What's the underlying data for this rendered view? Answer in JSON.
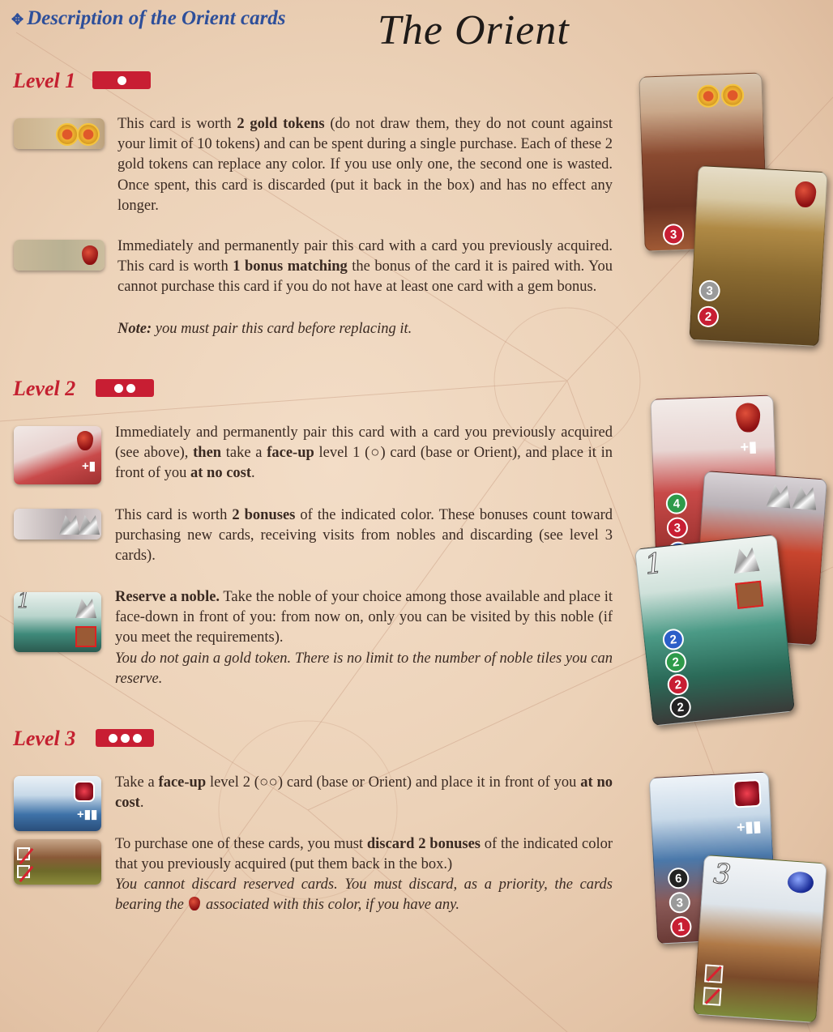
{
  "header": {
    "description": "Description of the Orient cards",
    "title": "The Orient"
  },
  "levels": [
    {
      "label": "Level 1",
      "blocks": [
        {
          "paragraph": [
            {
              "t": "This card is worth "
            },
            {
              "t": "2 gold tokens",
              "b": true
            },
            {
              "t": " (do not draw them, they do not count against your limit of 10 tokens) and can be spent during a single purchase. Each of these 2 gold tokens can replace any color. If you use only one, the second one is wasted. Once spent, this card is discarded (put it back in the box) and has no effect any longer."
            }
          ]
        },
        {
          "paragraph": [
            {
              "t": "Immediately and permanently pair this card with a card you previously acquired. This card is worth "
            },
            {
              "t": "1 bonus matching",
              "b": true
            },
            {
              "t": " the bonus of the card it is paired with. You cannot purchase this card if you do not have at least one card with a gem bonus."
            }
          ],
          "note": [
            {
              "t": "Note:",
              "b": true,
              "i": true
            },
            {
              "t": " you must pair this card before replacing it.",
              "i": true
            }
          ]
        }
      ]
    },
    {
      "label": "Level 2",
      "blocks": [
        {
          "paragraph": [
            {
              "t": "Immediately and permanently pair this card with a card you previously acquired (see above), "
            },
            {
              "t": "then",
              "b": true
            },
            {
              "t": " take a "
            },
            {
              "t": "face-up",
              "b": true
            },
            {
              "t": " level 1 (○) card (base or Orient), and place it in front of you "
            },
            {
              "t": "at no cost",
              "b": true
            },
            {
              "t": "."
            }
          ]
        },
        {
          "paragraph": [
            {
              "t": "This card is worth "
            },
            {
              "t": "2 bonuses",
              "b": true
            },
            {
              "t": " of the indicated color. These bonuses count toward purchasing new cards, receiving visits from nobles and discarding (see level 3 cards)."
            }
          ]
        },
        {
          "paragraph": [
            {
              "t": "Reserve a noble.",
              "b": true
            },
            {
              "t": " Take the noble of your choice among those available and place it face-down in front of you: from now on, only you can be visited by this noble (if you meet the requirements)."
            }
          ],
          "note": [
            {
              "t": "You do not gain a gold token. There is no limit to the number of noble tiles you can reserve.",
              "i": true
            }
          ]
        }
      ]
    },
    {
      "label": "Level 3",
      "blocks": [
        {
          "paragraph": [
            {
              "t": "Take a "
            },
            {
              "t": "face-up",
              "b": true
            },
            {
              "t": " level 2 (○○) card (base or Orient) and place it in front of you "
            },
            {
              "t": "at no cost",
              "b": true
            },
            {
              "t": "."
            }
          ]
        },
        {
          "paragraph": [
            {
              "t": "To purchase one of these cards, you must "
            },
            {
              "t": "discard 2 bonuses",
              "b": true
            },
            {
              "t": " of the indicated color that you previously acquired (put them back in the box.)"
            }
          ],
          "note": [
            {
              "t": "You cannot discard reserved cards. You must discard, as a priority, the cards bearing the ",
              "i": true
            },
            {
              "icon": "ruby-drop-icon"
            },
            {
              "t": " associated with this color, if you have any.",
              "i": true
            }
          ]
        }
      ]
    }
  ],
  "cards": {
    "l1a": {
      "cost": [
        "3"
      ]
    },
    "l1b": {
      "cost": [
        "3",
        "2"
      ]
    },
    "l2a": {
      "cost": [
        "4",
        "3",
        "1"
      ]
    },
    "l2c": {
      "number": "1",
      "cost": [
        "2",
        "2",
        "2",
        "2"
      ]
    },
    "l3a": {
      "cost": [
        "6",
        "3",
        "1"
      ]
    },
    "l3b": {
      "number": "3"
    }
  },
  "colors": {
    "accent_red": "#c81e33",
    "header_blue": "#2e4f9a"
  }
}
